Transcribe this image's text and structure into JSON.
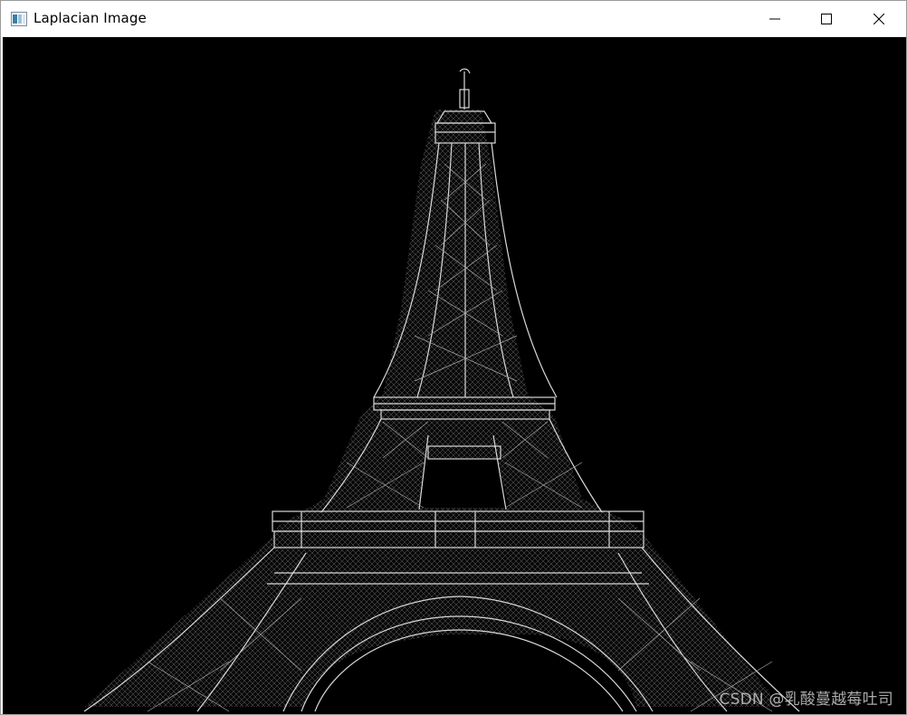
{
  "window": {
    "title": "Laplacian Image",
    "icon": "window-app-icon",
    "controls": {
      "minimize": "minimize-icon",
      "maximize": "maximize-icon",
      "close": "close-icon"
    }
  },
  "image": {
    "subject": "eiffel-tower-edge-map",
    "background_color": "#000000",
    "edge_color": "#d9d9d9"
  },
  "watermark": {
    "text": "CSDN @乳酸蔓越莓吐司"
  }
}
